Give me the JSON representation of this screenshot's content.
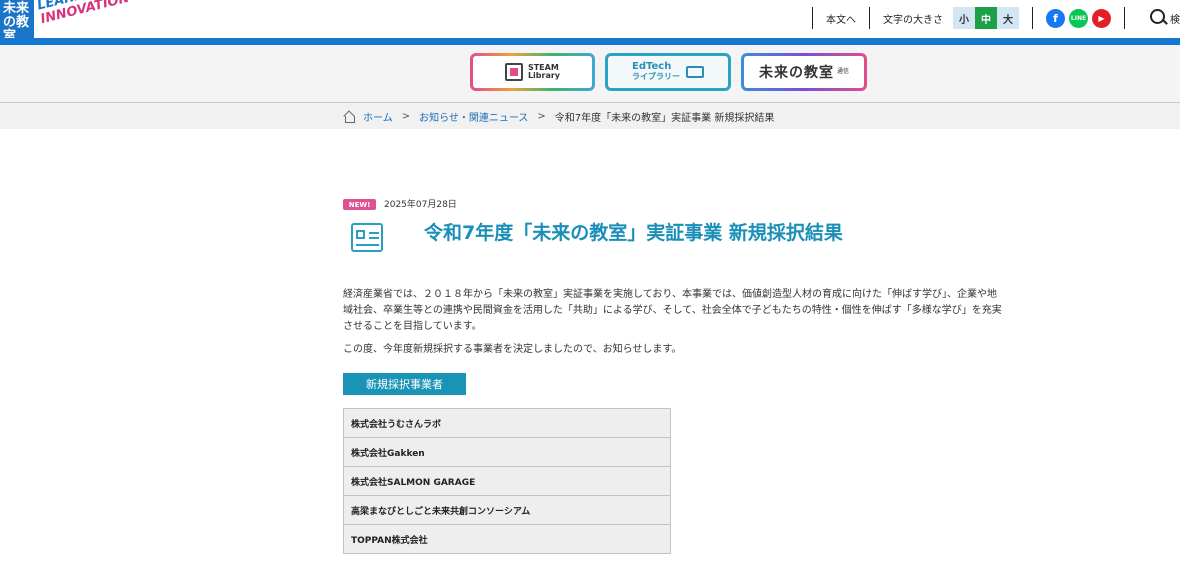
{
  "header": {
    "logo_ja": "未来の教室",
    "logo_en_1": "LEARNING",
    "logo_en_2": "INNOVATION",
    "skip_to_content": "本文へ",
    "font_size_label": "文字の大きさ",
    "font_sizes": [
      "小",
      "中",
      "大"
    ],
    "active_font_size": "中",
    "sns": [
      "facebook-icon",
      "line-icon",
      "youtube-icon"
    ],
    "search_label": "検"
  },
  "nav": {
    "steam": "STEAM Library",
    "steam_line1": "STEAM",
    "steam_line2": "Library",
    "edtech_line1": "EdTech",
    "edtech_line2": "ライブラリー",
    "mirai": "未来の教室",
    "mirai_sub": "通信"
  },
  "breadcrumb": {
    "home": "ホーム",
    "category": "お知らせ・関連ニュース",
    "current": "令和7年度「未来の教室」実証事業 新規採択結果",
    "separator": ">"
  },
  "article": {
    "badge": "NEW!",
    "date": "2025年07月28日",
    "title": "令和7年度「未来の教室」実証事業 新規採択結果",
    "paragraph1": "経済産業省では、２０１８年から「未来の教室」実証事業を実施しており、本事業では、価値創造型人材の育成に向けた「伸ばす学び」、企業や地域社会、卒業生等との連携や民間資金を活用した「共助」による学び、そして、社会全体で子どもたちの特性・個性を伸ばす「多様な学び」を充実させることを目指しています。",
    "paragraph2": "この度、今年度新規採択する事業者を決定しましたので、お知らせします。",
    "section_heading": "新規採択事業者",
    "companies": [
      "株式会社うむさんラボ",
      "株式会社Gakken",
      "株式会社SALMON GARAGE",
      "高梁まなびとしごと未来共創コンソーシアム",
      "TOPPAN株式会社"
    ]
  },
  "colors": {
    "brand_blue": "#1477d0",
    "title_teal": "#1a8fb8",
    "badge_pink": "#de4f94",
    "active_size_green": "#1ea04a"
  }
}
